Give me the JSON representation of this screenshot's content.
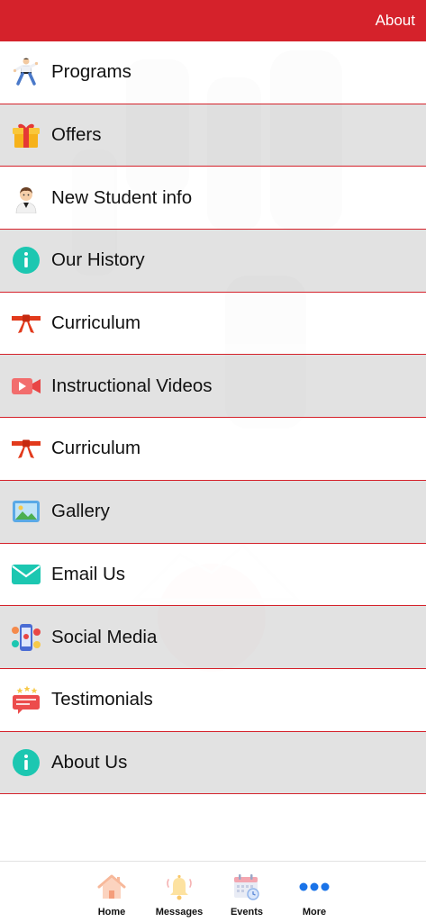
{
  "header": {
    "title": "About"
  },
  "menu": [
    {
      "label": "Programs",
      "icon": "karate-kid-icon"
    },
    {
      "label": "Offers",
      "icon": "gift-icon"
    },
    {
      "label": "New Student info",
      "icon": "student-icon"
    },
    {
      "label": "Our History",
      "icon": "info-icon"
    },
    {
      "label": "Curriculum",
      "icon": "belt-icon"
    },
    {
      "label": "Instructional Videos",
      "icon": "video-camera-icon"
    },
    {
      "label": "Curriculum",
      "icon": "belt-icon"
    },
    {
      "label": "Gallery",
      "icon": "gallery-icon"
    },
    {
      "label": "Email Us",
      "icon": "envelope-icon"
    },
    {
      "label": "Social Media",
      "icon": "social-media-icon"
    },
    {
      "label": "Testimonials",
      "icon": "testimonial-icon"
    },
    {
      "label": "About Us",
      "icon": "info-icon"
    }
  ],
  "tabbar": {
    "home": "Home",
    "messages": "Messages",
    "events": "Events",
    "more": "More"
  },
  "colors": {
    "accent": "#d5222b",
    "info": "#1cc7b1",
    "belt": "#e23a1c",
    "more": "#1a73e8"
  }
}
